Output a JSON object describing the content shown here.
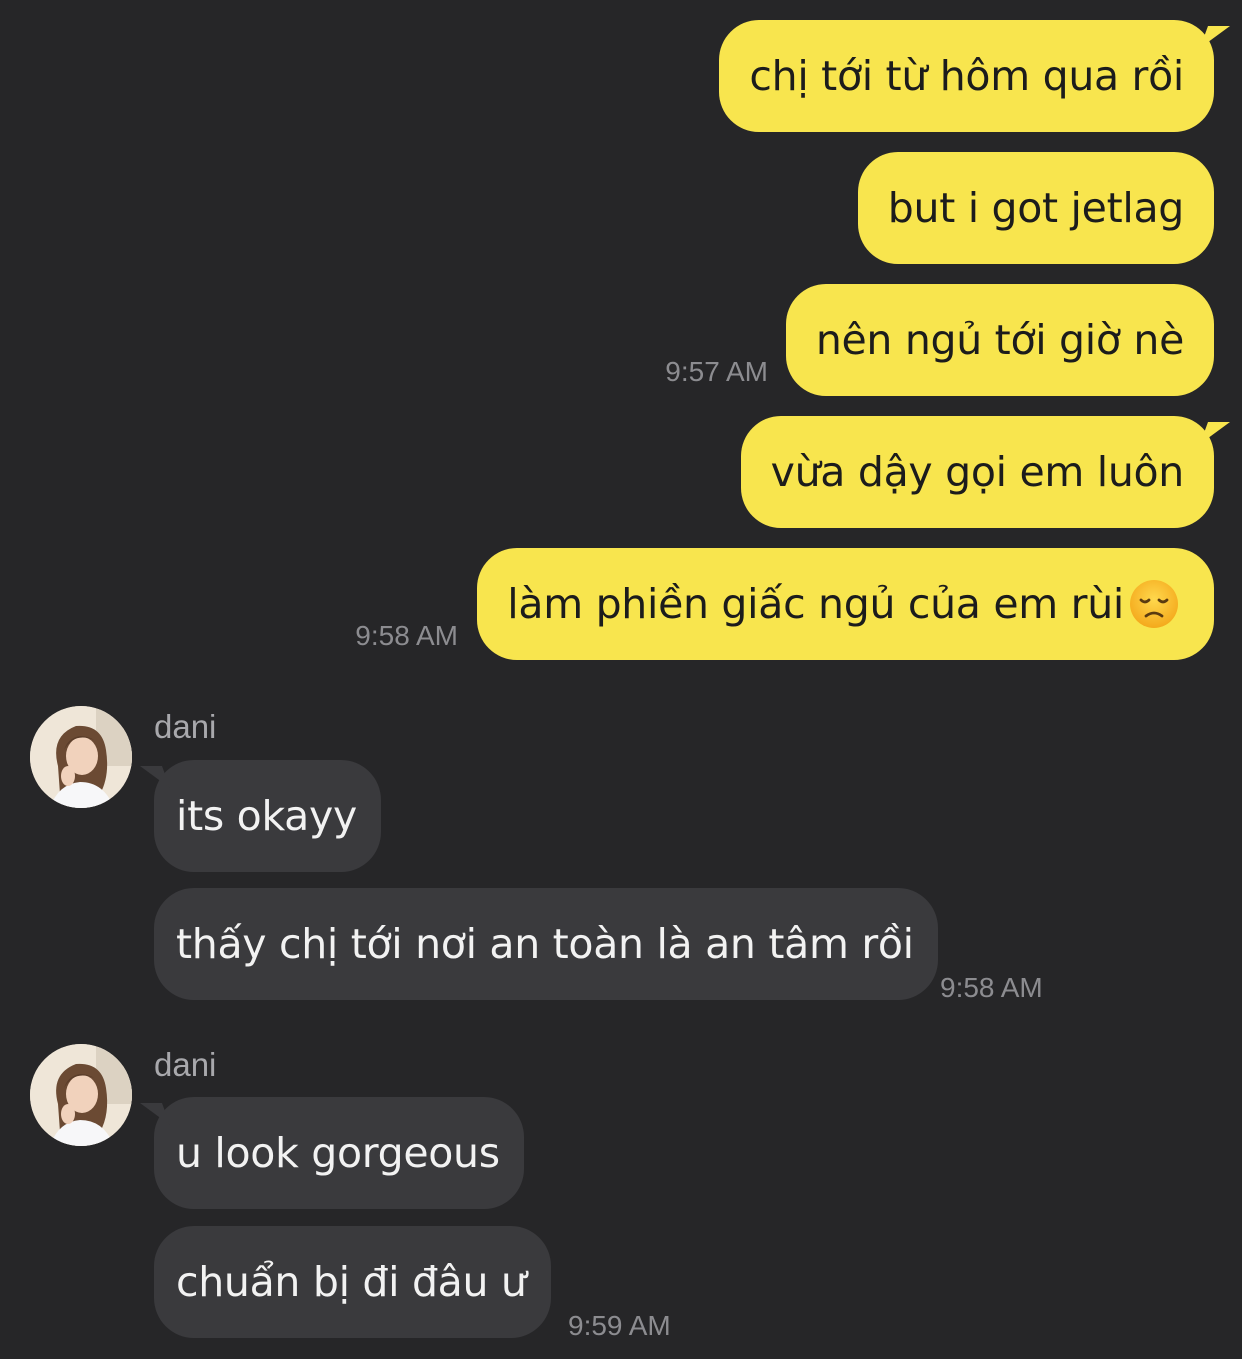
{
  "messages_sent": [
    {
      "text": "chị tới từ hôm qua rồi"
    },
    {
      "text": "but i got jetlag"
    },
    {
      "text": "nên ngủ tới giờ nè",
      "time": "9:57 AM"
    },
    {
      "text": "vừa dậy gọi em luôn"
    },
    {
      "text": "làm phiền giấc ngủ của em rùi",
      "emoji": "disappointed-face",
      "time": "9:58 AM"
    }
  ],
  "groups_received": [
    {
      "sender": "dani",
      "avatar": "profile-photo",
      "messages": [
        {
          "text": "its okayy"
        },
        {
          "text": "thấy chị tới nơi an toàn là an tâm rồi",
          "time": "9:58 AM"
        }
      ]
    },
    {
      "sender": "dani",
      "avatar": "profile-photo",
      "messages": [
        {
          "text": "u look gorgeous"
        },
        {
          "text": "chuẩn bị đi đâu ư",
          "time": "9:59 AM"
        }
      ]
    }
  ],
  "colors": {
    "background": "#262628",
    "sent_bubble": "#f8e54e",
    "received_bubble": "#3a3a3d",
    "timestamp": "#8c8c90"
  }
}
